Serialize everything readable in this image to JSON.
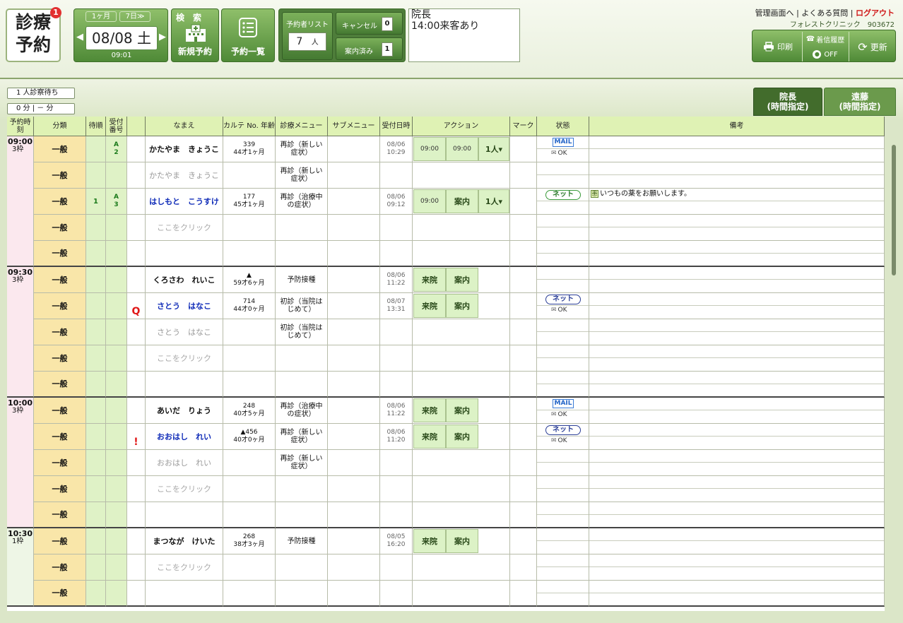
{
  "logo": {
    "line1": "診療",
    "line2": "予約",
    "badge": "1"
  },
  "date_nav": {
    "month_tab": "1ヶ月",
    "week_tab": "7日≫",
    "date": "08/08 土",
    "time": "09:01",
    "prev": "◀",
    "next": "▶"
  },
  "toolbar": {
    "search_label": "検　索",
    "new_label": "新規予約",
    "list_label": "予約一覧"
  },
  "stats": {
    "list_label": "予約者リスト",
    "list_count": "7",
    "list_unit": "人",
    "cancel_label": "キャンセル",
    "cancel_count": "0",
    "guided_label": "案内済み",
    "guided_count": "1"
  },
  "memo": {
    "line1": "院長",
    "line2": "14:00来客あり"
  },
  "top_links": {
    "admin": "管理画面へ",
    "faq": "よくある質問",
    "logout": "ログアウト",
    "sep": "|",
    "clinic": "フォレストクリニック　903672"
  },
  "right_buttons": {
    "print": "印刷",
    "history": "着信履歴",
    "off": "OFF",
    "refresh": "更新"
  },
  "waiting": {
    "label": "1 人診察待ち",
    "minutes": "0 分 | － 分"
  },
  "doctors": [
    {
      "name": "院長",
      "sub": "(時間指定)"
    },
    {
      "name": "遠藤",
      "sub": "(時間指定)"
    }
  ],
  "columns": [
    "予約時刻",
    "分類",
    "待順",
    "受付番号",
    "",
    "なまえ",
    "カルテ No. 年齢",
    "診療メニュー",
    "サブメニュー",
    "受付日時",
    "アクション",
    "マーク",
    "状態",
    "備考"
  ],
  "slots": [
    {
      "time": "09:00",
      "slots_label": "3枠",
      "rows": [
        {
          "cat": "一般",
          "wait": "",
          "recv": "A 2",
          "mark": "",
          "name": "かたやま　きょうこ",
          "name_style": "dark",
          "karte": "339",
          "age": "44才1ヶ月",
          "menu": "再診（新しい症状）",
          "rdate": "08/06",
          "rtime": "10:29",
          "actions": [
            "09:00",
            "09:00",
            "1人▾"
          ],
          "status": "MAIL",
          "ok": "OK",
          "note": ""
        },
        {
          "cat": "一般",
          "wait": "",
          "recv": "",
          "mark": "",
          "name": "かたやま　きょうこ",
          "name_style": "gray",
          "karte": "",
          "age": "",
          "menu": "再診（新しい症状）",
          "rdate": "",
          "rtime": "",
          "actions": [],
          "status": "",
          "ok": "",
          "note": ""
        },
        {
          "cat": "一般",
          "wait": "1",
          "recv": "A 3",
          "mark": "",
          "name": "はしもと　こうすけ",
          "name_style": "blue",
          "karte": "177",
          "age": "45才1ヶ月",
          "menu": "再診（治療中の症状）",
          "rdate": "08/06",
          "rtime": "09:12",
          "actions": [
            "09:00",
            "案内",
            "1人▾"
          ],
          "status": "ネット",
          "status_color": "green",
          "ok": "",
          "note": "いつもの薬をお願いします。"
        },
        {
          "cat": "一般",
          "wait": "",
          "recv": "",
          "mark": "",
          "name": "ここをクリック",
          "name_style": "hint",
          "karte": "",
          "age": "",
          "menu": "",
          "rdate": "",
          "rtime": "",
          "actions": [],
          "status": "",
          "ok": "",
          "note": ""
        },
        {
          "cat": "一般",
          "wait": "",
          "recv": "",
          "mark": "",
          "name": "",
          "name_style": "hint",
          "karte": "",
          "age": "",
          "menu": "",
          "rdate": "",
          "rtime": "",
          "actions": [],
          "status": "",
          "ok": "",
          "note": ""
        }
      ]
    },
    {
      "time": "09:30",
      "slots_label": "3枠",
      "rows": [
        {
          "cat": "一般",
          "wait": "",
          "recv": "",
          "mark": "",
          "name": "くろさわ　れいこ",
          "name_style": "dark",
          "karte": "▲",
          "age": "59才6ヶ月",
          "menu": "予防接種",
          "rdate": "08/06",
          "rtime": "11:22",
          "actions": [
            "来院",
            "案内"
          ],
          "status": "",
          "ok": "",
          "note": ""
        },
        {
          "cat": "一般",
          "wait": "",
          "recv": "",
          "mark": "Q",
          "name": "さとう　はなこ",
          "name_style": "blue",
          "karte": "714",
          "age": "44才0ヶ月",
          "menu": "初診（当院はじめて）",
          "rdate": "08/07",
          "rtime": "13:31",
          "actions": [
            "来院",
            "案内"
          ],
          "status": "ネット",
          "status_color": "blue",
          "ok": "OK",
          "note": ""
        },
        {
          "cat": "一般",
          "wait": "",
          "recv": "",
          "mark": "",
          "name": "さとう　はなこ",
          "name_style": "gray",
          "karte": "",
          "age": "",
          "menu": "初診（当院はじめて）",
          "rdate": "",
          "rtime": "",
          "actions": [],
          "status": "",
          "ok": "",
          "note": ""
        },
        {
          "cat": "一般",
          "wait": "",
          "recv": "",
          "mark": "",
          "name": "ここをクリック",
          "name_style": "hint",
          "karte": "",
          "age": "",
          "menu": "",
          "rdate": "",
          "rtime": "",
          "actions": [],
          "status": "",
          "ok": "",
          "note": ""
        },
        {
          "cat": "一般",
          "wait": "",
          "recv": "",
          "mark": "",
          "name": "",
          "name_style": "hint",
          "karte": "",
          "age": "",
          "menu": "",
          "rdate": "",
          "rtime": "",
          "actions": [],
          "status": "",
          "ok": "",
          "note": ""
        }
      ]
    },
    {
      "time": "10:00",
      "slots_label": "3枠",
      "rows": [
        {
          "cat": "一般",
          "wait": "",
          "recv": "",
          "mark": "",
          "name": "あいだ　りょう",
          "name_style": "dark",
          "karte": "248",
          "age": "40才5ヶ月",
          "menu": "再診（治療中の症状）",
          "rdate": "08/06",
          "rtime": "11:22",
          "actions": [
            "来院",
            "案内"
          ],
          "status": "MAIL",
          "ok": "OK",
          "note": ""
        },
        {
          "cat": "一般",
          "wait": "",
          "recv": "",
          "mark": "!",
          "name": "おおはし　れい",
          "name_style": "blue",
          "karte": "▲456",
          "age": "40才0ヶ月",
          "menu": "再診（新しい症状）",
          "rdate": "08/06",
          "rtime": "11:20",
          "actions": [
            "来院",
            "案内"
          ],
          "status": "ネット",
          "status_color": "blue",
          "ok": "OK",
          "note": ""
        },
        {
          "cat": "一般",
          "wait": "",
          "recv": "",
          "mark": "",
          "name": "おおはし　れい",
          "name_style": "gray",
          "karte": "",
          "age": "",
          "menu": "再診（新しい症状）",
          "rdate": "",
          "rtime": "",
          "actions": [],
          "status": "",
          "ok": "",
          "note": ""
        },
        {
          "cat": "一般",
          "wait": "",
          "recv": "",
          "mark": "",
          "name": "ここをクリック",
          "name_style": "hint",
          "karte": "",
          "age": "",
          "menu": "",
          "rdate": "",
          "rtime": "",
          "actions": [],
          "status": "",
          "ok": "",
          "note": ""
        },
        {
          "cat": "一般",
          "wait": "",
          "recv": "",
          "mark": "",
          "name": "",
          "name_style": "hint",
          "karte": "",
          "age": "",
          "menu": "",
          "rdate": "",
          "rtime": "",
          "actions": [],
          "status": "",
          "ok": "",
          "note": ""
        }
      ]
    },
    {
      "time": "10:30",
      "slots_label": "1枠",
      "rows": [
        {
          "cat": "一般",
          "wait": "",
          "recv": "",
          "mark": "",
          "name": "まつなが　けいた",
          "name_style": "dark",
          "karte": "268",
          "age": "38才3ヶ月",
          "menu": "予防接種",
          "rdate": "08/05",
          "rtime": "16:20",
          "actions": [
            "来院",
            "案内"
          ],
          "status": "",
          "ok": "",
          "note": ""
        },
        {
          "cat": "一般",
          "wait": "",
          "recv": "",
          "mark": "",
          "name": "ここをクリック",
          "name_style": "hint",
          "karte": "",
          "age": "",
          "menu": "",
          "rdate": "",
          "rtime": "",
          "actions": [],
          "status": "",
          "ok": "",
          "note": ""
        },
        {
          "cat": "一般",
          "wait": "",
          "recv": "",
          "mark": "",
          "name": "",
          "name_style": "hint",
          "karte": "",
          "age": "",
          "menu": "",
          "rdate": "",
          "rtime": "",
          "actions": [],
          "status": "",
          "ok": "",
          "note": ""
        }
      ]
    }
  ]
}
